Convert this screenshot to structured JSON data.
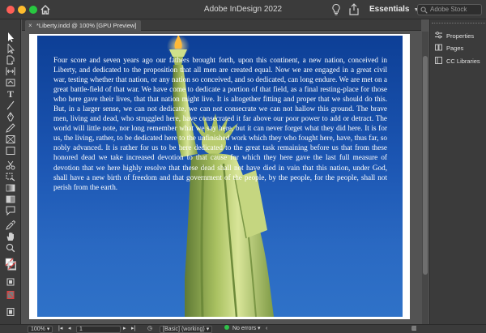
{
  "window": {
    "title": "Adobe InDesign 2022",
    "workspace": "Essentials",
    "search_placeholder": "Adobe Stock"
  },
  "document_tab": {
    "label": "*Liberty.indd @ 100% [GPU Preview]",
    "close_glyph": "×"
  },
  "toolbar": {
    "tools": [
      "selection-tool",
      "direct-selection-tool",
      "page-tool",
      "gap-tool",
      "content-collector-tool",
      "type-tool",
      "line-tool",
      "pen-tool",
      "pencil-tool",
      "rectangle-frame-tool",
      "rectangle-tool",
      "scissors-tool",
      "free-transform-tool",
      "gradient-swatch-tool",
      "gradient-feather-tool",
      "note-tool",
      "eyedropper-tool",
      "hand-tool",
      "zoom-tool",
      "fill-stroke-swatch",
      "apply-color-button",
      "normal-mode-button",
      "preview-mode-button"
    ]
  },
  "panels": {
    "items": [
      {
        "label": "Properties",
        "icon": "properties-icon"
      },
      {
        "label": "Pages",
        "icon": "pages-icon"
      },
      {
        "label": "CC Libraries",
        "icon": "cc-libraries-icon"
      }
    ]
  },
  "document": {
    "body": "Four score and seven years ago our fathers brought forth, upon this continent, a new nation, conceived in Liberty, and dedicated to the proposition that all men are created equal. Now we are engaged in a great civil war, testing whether that nation, or any nation so conceived, and so dedicated, can long endure. We are met on a great battle-field of that war. We have come to dedicate a portion of that field, as a final resting-place for those who here gave their lives, that that nation might live. It is altogether fitting and proper that we should do this. But, in a larger sense, we can not dedicate, we can not consecrate we can not hallow this ground. The brave men, living and dead, who struggled here, have consecrated it far above our poor power to add or detract. The world will little note, nor long remember what we say here, but it can never forget what they did here. It is for us, the living, rather, to be dedicated here to the unfinished work which they who fought here, have, thus far, so nobly advanced. It is rather for us to be here dedicated to the great task remaining before us that from these honored dead we take increased devotion to that cause for which they here gave the last full measure of devotion that we here highly resolve that these dead shall not have died in vain that this nation, under God, shall have a new birth of freedom and that government of the people, by the people, for the people, shall not perish from the earth."
  },
  "status": {
    "zoom": "100%",
    "page_number": "1",
    "preflight_profile": "[Basic] (working)",
    "errors": "No errors",
    "error_status_color": "#2fc24a"
  },
  "colors": {
    "chrome": "#3b3b3b",
    "pasteboard": "#535353",
    "sky_top": "#0d3f96",
    "sky_bottom": "#2f72c8"
  }
}
